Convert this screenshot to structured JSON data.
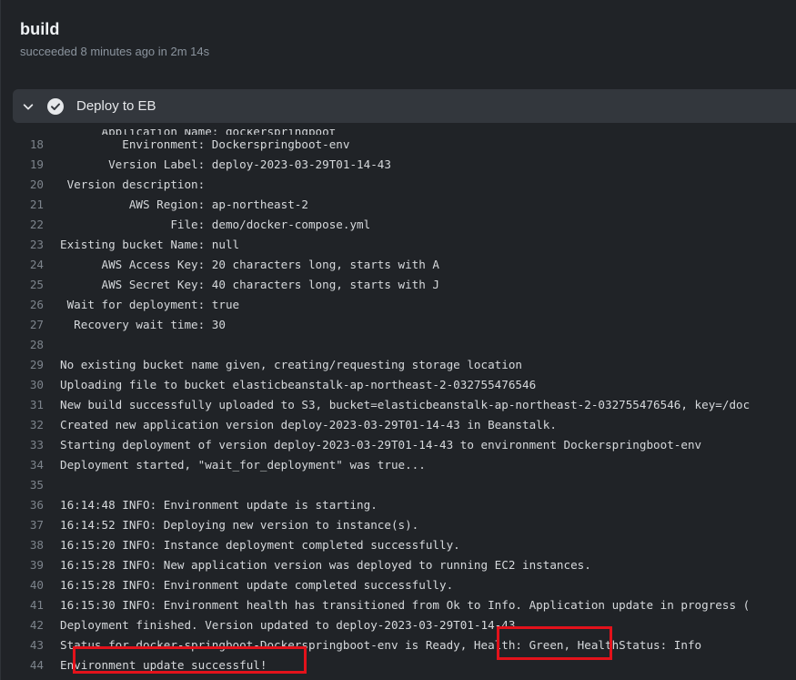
{
  "job": {
    "title": "build",
    "subtitle": "succeeded 8 minutes ago in 2m 14s"
  },
  "step": {
    "title": "Deploy to EB",
    "status_icon": "check-circle-icon",
    "toggle_icon": "chevron-down-icon"
  },
  "log_lines": [
    {
      "n": "",
      "t": "      Application Name: dockerspringboot"
    },
    {
      "n": "18",
      "t": "         Environment: Dockerspringboot-env"
    },
    {
      "n": "19",
      "t": "       Version Label: deploy-2023-03-29T01-14-43"
    },
    {
      "n": "20",
      "t": " Version description:"
    },
    {
      "n": "21",
      "t": "          AWS Region: ap-northeast-2"
    },
    {
      "n": "22",
      "t": "                File: demo/docker-compose.yml"
    },
    {
      "n": "23",
      "t": "Existing bucket Name: null"
    },
    {
      "n": "24",
      "t": "      AWS Access Key: 20 characters long, starts with A"
    },
    {
      "n": "25",
      "t": "      AWS Secret Key: 40 characters long, starts with J"
    },
    {
      "n": "26",
      "t": " Wait for deployment: true"
    },
    {
      "n": "27",
      "t": "  Recovery wait time: 30"
    },
    {
      "n": "28",
      "t": ""
    },
    {
      "n": "29",
      "t": "No existing bucket name given, creating/requesting storage location"
    },
    {
      "n": "30",
      "t": "Uploading file to bucket elasticbeanstalk-ap-northeast-2-032755476546"
    },
    {
      "n": "31",
      "t": "New build successfully uploaded to S3, bucket=elasticbeanstalk-ap-northeast-2-032755476546, key=/doc"
    },
    {
      "n": "32",
      "t": "Created new application version deploy-2023-03-29T01-14-43 in Beanstalk."
    },
    {
      "n": "33",
      "t": "Starting deployment of version deploy-2023-03-29T01-14-43 to environment Dockerspringboot-env"
    },
    {
      "n": "34",
      "t": "Deployment started, \"wait_for_deployment\" was true..."
    },
    {
      "n": "35",
      "t": ""
    },
    {
      "n": "36",
      "t": "16:14:48 INFO: Environment update is starting."
    },
    {
      "n": "37",
      "t": "16:14:52 INFO: Deploying new version to instance(s)."
    },
    {
      "n": "38",
      "t": "16:15:20 INFO: Instance deployment completed successfully."
    },
    {
      "n": "39",
      "t": "16:15:28 INFO: New application version was deployed to running EC2 instances."
    },
    {
      "n": "40",
      "t": "16:15:28 INFO: Environment update completed successfully."
    },
    {
      "n": "41",
      "t": "16:15:30 INFO: Environment health has transitioned from Ok to Info. Application update in progress ("
    },
    {
      "n": "42",
      "t": "Deployment finished. Version updated to deploy-2023-03-29T01-14-43"
    },
    {
      "n": "43",
      "t": "Status for docker-springboot-Dockerspringboot-env is Ready, Health: Green, HealthStatus: Info"
    },
    {
      "n": "44",
      "t": "Environment update successful!"
    }
  ],
  "colors": {
    "background": "#202327",
    "header_bar": "#33373d",
    "highlight": "#e3121b"
  }
}
